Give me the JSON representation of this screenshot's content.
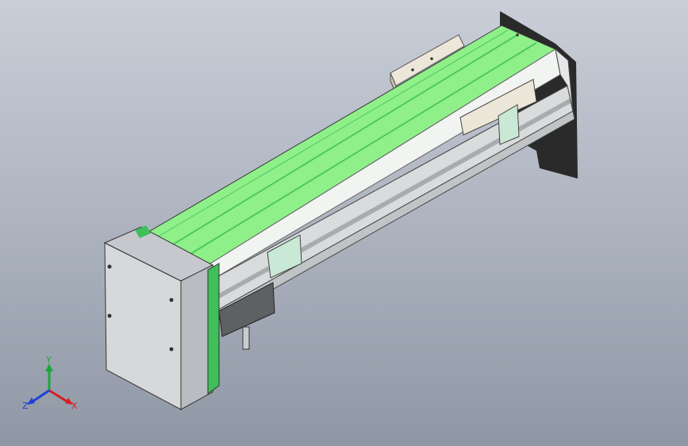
{
  "triad": {
    "x_label": "X",
    "y_label": "Y",
    "z_label": "Z",
    "colors": {
      "x": "#d62020",
      "y": "#1aa83a",
      "z": "#2040d8"
    }
  },
  "colors": {
    "belt": "#8ff08a",
    "belt_dark": "#3fbf5a",
    "frame": "#d9dbdc",
    "frame_shadow": "#a9acae",
    "motor_box": "#d6d8da",
    "bracket": "#ece7d8",
    "shadow": "#2a2a2a"
  },
  "icons": [
    "coordinate-triad-icon"
  ]
}
